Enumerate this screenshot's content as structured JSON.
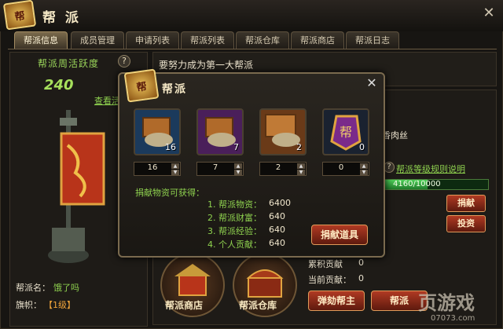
{
  "header": {
    "logo_text": "帮",
    "title": "帮 派",
    "close": "✕"
  },
  "tabs": [
    "帮派信息",
    "成员管理",
    "申请列表",
    "帮派列表",
    "帮派仓库",
    "帮派商店",
    "帮派日志"
  ],
  "left": {
    "activity_title": "帮派周活跃度",
    "help": "?",
    "activity_value": "240",
    "lookup_link": "查看活",
    "name_label": "帮派名：",
    "name_value": "饿了吗",
    "level_label": "旗帜：",
    "level_value": "【1级】"
  },
  "right": {
    "notice": "要努力成为第一大帮派",
    "meat": "香肉丝",
    "help": "?",
    "rule_link": "帮派等级规则说明",
    "progress_text": "4160/10000",
    "progress_fraction": 0.416,
    "donate_btn": "捐献",
    "invest_btn": "投资",
    "total_contrib_label": "累积贡献",
    "total_contrib_value": "0",
    "cur_contrib_label": "当前贡献：",
    "cur_contrib_value": "0",
    "impeach_btn": "弹劾帮主",
    "btn2": "帮派"
  },
  "features": [
    {
      "label": "帮派商店",
      "icon": "shop-icon"
    },
    {
      "label": "帮派仓库",
      "icon": "chest-icon"
    }
  ],
  "watermark": {
    "text": "页游戏",
    "sub": "07073.com"
  },
  "modal": {
    "logo_text": "帮",
    "title": "帮派",
    "close": "✕",
    "items": [
      {
        "count": "16",
        "input": "16",
        "icon": "crate-small-icon",
        "bg": "#1b3a5c"
      },
      {
        "count": "7",
        "input": "7",
        "icon": "crate-medium-icon",
        "bg": "#4a1f5a"
      },
      {
        "count": "2",
        "input": "2",
        "icon": "crate-large-icon",
        "bg": "#6a3a18"
      },
      {
        "count": "0",
        "input": "0",
        "icon": "banner-token-icon",
        "bg": "#1a2230"
      }
    ],
    "reward_title": "捐献物资可获得：",
    "rewards": [
      {
        "label": "1. 帮派物资：",
        "value": "6400"
      },
      {
        "label": "2. 帮派财富：",
        "value": "640"
      },
      {
        "label": "3. 帮派经验：",
        "value": "640"
      },
      {
        "label": "4. 个人贡献：",
        "value": "640"
      }
    ],
    "donate_btn": "捐献道具"
  }
}
